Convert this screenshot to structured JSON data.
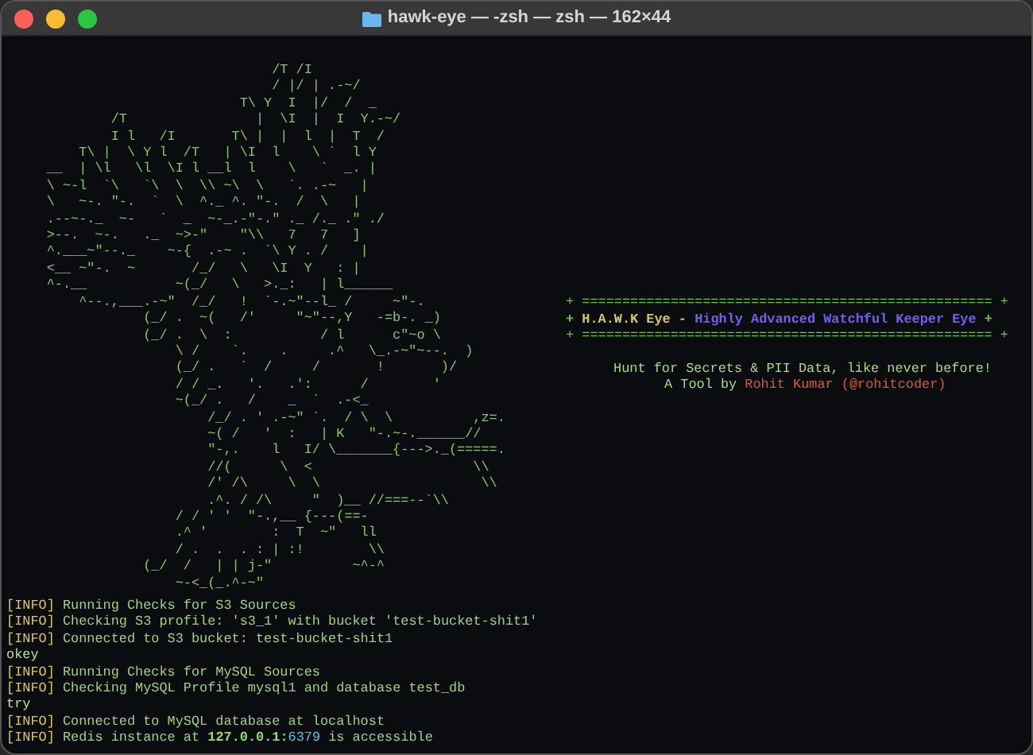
{
  "window": {
    "title": "hawk-eye — -zsh — zsh — 162×44"
  },
  "ascii_art": [
    "                                 /T /I",
    "                                 / |/ | .-~/",
    "                             T\\ Y  I  |/  /  _",
    "             /T                |  \\I  |  I  Y.-~/",
    "             I l   /I       T\\ |  |  l  |  T  /",
    "         T\\ |  \\ Y l  /T   | \\I  l    \\ `  l Y",
    "     __  | \\l   \\l  \\I l __l  l    \\   `  _. |",
    "     \\ ~-l  `\\   `\\  \\  \\\\ ~\\  \\   `. .-~   |",
    "     \\   ~-. \"-.  `  \\  ^._ ^. \"-.  /  \\   |",
    "     .--~-._  ~-   `  _  ~-_.-\"-.\" ._ /._ .\" ./",
    "     >--.  ~-.   ._  ~>-\"    \"\\\\   7   7   ]",
    "     ^.___~\"--._    ~-{  .-~ .  `\\ Y . /    |",
    "     <__ ~\"-.  ~       /_/   \\   \\I  Y   : |",
    "     ^-.__           ~(_/   \\   >._:   | l______",
    "         ^--.,___.-~\"  /_/   !  `-.~\"--l_ /     ~\"-.",
    "                 (_/ .  ~(   /'     \"~\"--,Y   -=b-. _)",
    "                 (_/ .  \\  :           / l      c\"~o \\",
    "                     \\ /    `.    .     .^   \\_.-~\"~--.  )",
    "                     (_/ .   `  /     /       !       )/",
    "                     / / _.   '.   .':      /        '",
    "                     ~(_/ .   /    _  `  .-<_",
    "                         /_/ . ' .-~\" `.  / \\  \\          ,z=.",
    "                         ~( /   '  :   | K   \"-.~-.______//",
    "                         \"-,.    l   I/ \\_______{--->._(=====.",
    "                         //(      \\  <                    \\\\",
    "                         /' /\\     \\  \\                    \\\\",
    "                         .^. / /\\     \"  )__ //===--`\\\\",
    "                     / / ' '  \"-.,__ {---(==-",
    "                     .^ '        :  T  ~\"   ll",
    "                     / .  .  . : | :!        \\\\",
    "                 (_/  /   | | j-\"          ~^-^",
    "                     ~-<_(_.^-~\""
  ],
  "banner": {
    "borders": [
      "+ =================================================== +",
      "+ =================================================== +"
    ],
    "title_start": "+",
    "title_prefix": "H.A.W.K Eye -",
    "title": "Highly Advanced Watchful Keeper Eye",
    "title_end": "+",
    "tagline": "Hunt for Secrets & PII Data, like never before!",
    "credit_prefix": "A Tool by",
    "author": "Rohit Kumar (@rohitcoder)"
  },
  "log": [
    {
      "kind": "info",
      "tag": "[INFO]",
      "text": "Running Checks for S3 Sources"
    },
    {
      "kind": "info",
      "tag": "[INFO]",
      "text": "Checking S3 profile: 's3_1' with bucket 'test-bucket-shit1'"
    },
    {
      "kind": "info",
      "tag": "[INFO]",
      "text": "Connected to S3 bucket: test-bucket-shit1"
    },
    {
      "kind": "plain",
      "text": "okey"
    },
    {
      "kind": "info",
      "tag": "[INFO]",
      "text": "Running Checks for MySQL Sources"
    },
    {
      "kind": "info",
      "tag": "[INFO]",
      "text": "Checking MySQL Profile mysql1 and database test_db"
    },
    {
      "kind": "plain",
      "text": "try"
    },
    {
      "kind": "info",
      "tag": "[INFO]",
      "text": "Connected to MySQL database at localhost"
    },
    {
      "kind": "endpoint",
      "tag": "[INFO]",
      "text": "Redis instance at",
      "host": "127.0.0.1:",
      "port": "6379",
      "suffix": "is accessible"
    }
  ]
}
